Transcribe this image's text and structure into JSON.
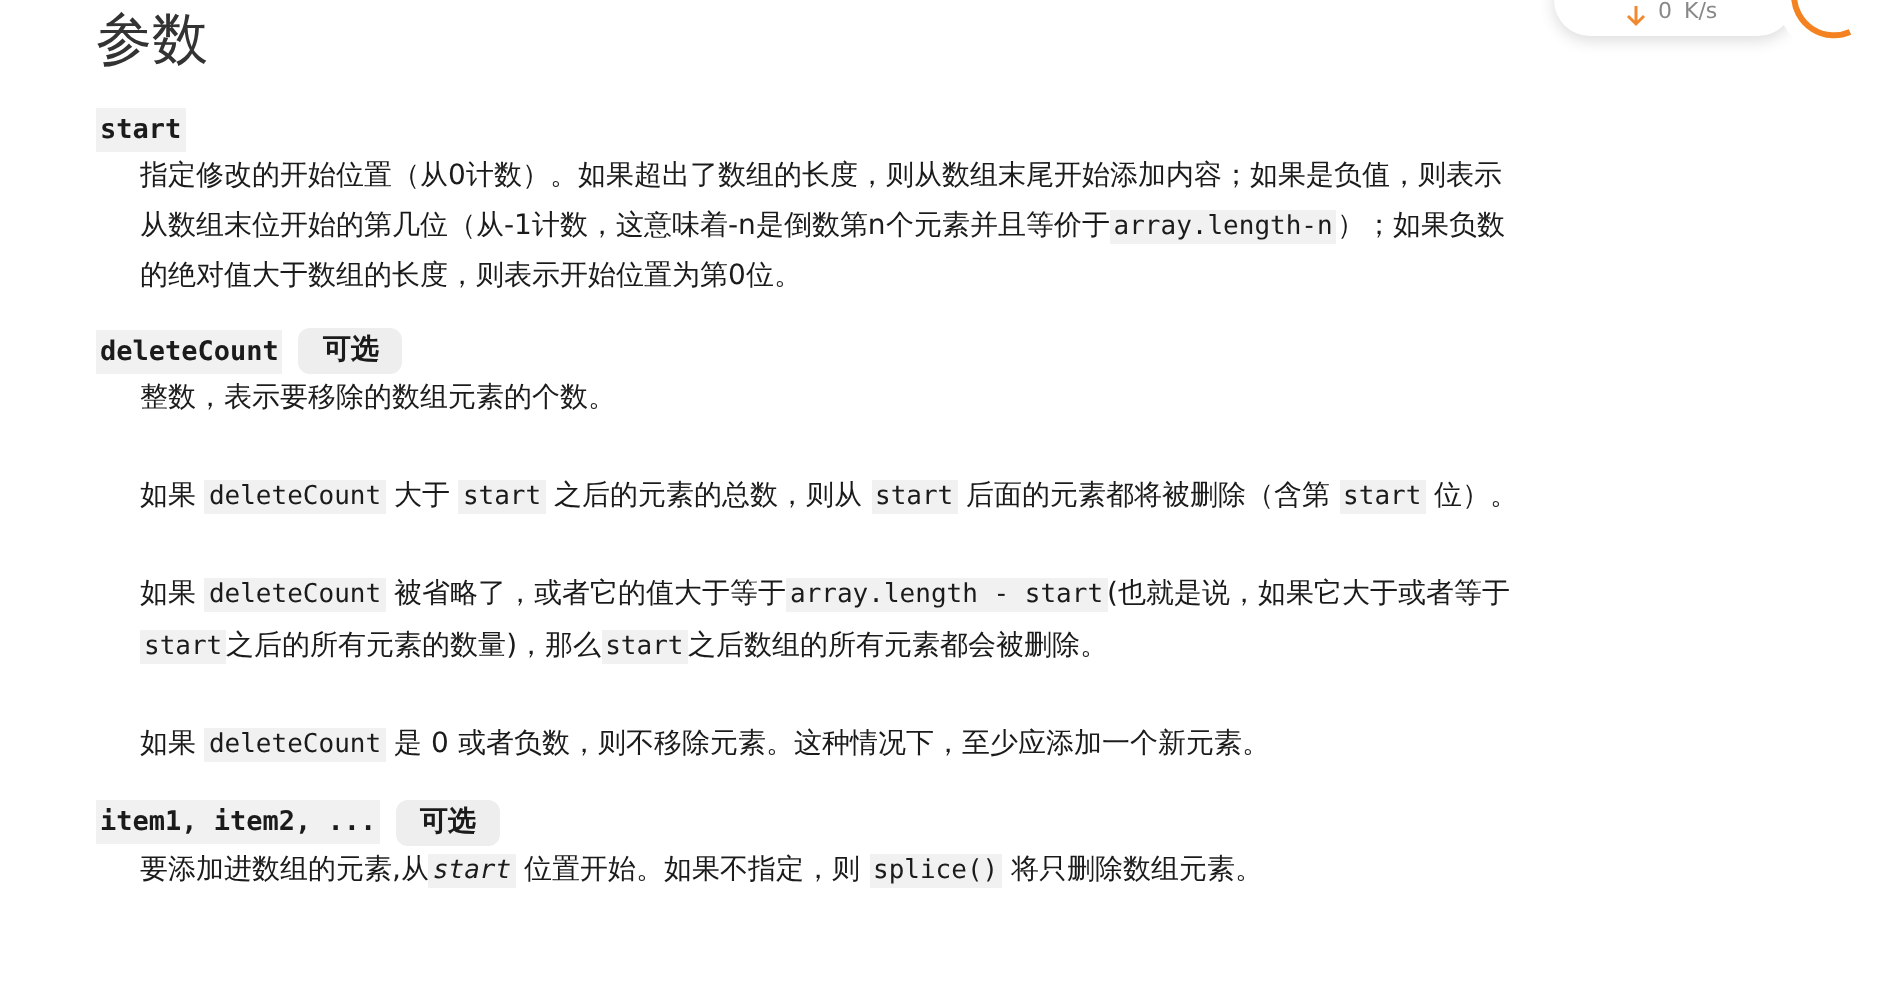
{
  "title": "参数",
  "speed_widget": {
    "value": "0",
    "unit": "K/s"
  },
  "params": [
    {
      "name": "start",
      "paragraphs": [
        [
          {
            "kind": "text",
            "text": "指定修改的开始位置（从0计数）。如果超出了数组的长度，则从数组末尾开始添加内容；如果是负值，则表示从数组末位开始的第几位（从-1计数，这意味着-n是倒数第n个元素并且等价于"
          },
          {
            "kind": "code",
            "text": "array.length-n"
          },
          {
            "kind": "text",
            "text": "）；如果负数的绝对值大于数组的长度，则表示开始位置为第0位。"
          }
        ]
      ]
    },
    {
      "name": "deleteCount",
      "badge": "可选",
      "paragraphs": [
        [
          {
            "kind": "text",
            "text": "整数，表示要移除的数组元素的个数。"
          }
        ],
        [
          {
            "kind": "text",
            "text": "如果 "
          },
          {
            "kind": "code",
            "text": "deleteCount"
          },
          {
            "kind": "text",
            "text": " 大于 "
          },
          {
            "kind": "code",
            "text": "start"
          },
          {
            "kind": "text",
            "text": " 之后的元素的总数，则从 "
          },
          {
            "kind": "code",
            "text": "start"
          },
          {
            "kind": "text",
            "text": " 后面的元素都将被删除（含第 "
          },
          {
            "kind": "code",
            "text": "start"
          },
          {
            "kind": "text",
            "text": " 位）。"
          }
        ],
        [
          {
            "kind": "text",
            "text": "如果 "
          },
          {
            "kind": "code",
            "text": "deleteCount"
          },
          {
            "kind": "text",
            "text": " 被省略了，或者它的值大于等于"
          },
          {
            "kind": "code",
            "text": "array.length - start"
          },
          {
            "kind": "text",
            "text": "(也就是说，如果它大于或者等于"
          },
          {
            "kind": "code",
            "text": "start"
          },
          {
            "kind": "text",
            "text": "之后的所有元素的数量)，那么"
          },
          {
            "kind": "code",
            "text": "start"
          },
          {
            "kind": "text",
            "text": "之后数组的所有元素都会被删除。"
          }
        ],
        [
          {
            "kind": "text",
            "text": "如果 "
          },
          {
            "kind": "code",
            "text": "deleteCount"
          },
          {
            "kind": "text",
            "text": " 是 0 或者负数，则不移除元素。这种情况下，至少应添加一个新元素。"
          }
        ]
      ]
    },
    {
      "name": "item1, item2, ...",
      "badge": "可选",
      "paragraphs": [
        [
          {
            "kind": "text",
            "text": "要添加进数组的元素,从"
          },
          {
            "kind": "code_italic",
            "text": "start"
          },
          {
            "kind": "text",
            "text": " 位置开始。如果不指定，则 "
          },
          {
            "kind": "code",
            "text": "splice()"
          },
          {
            "kind": "text",
            "text": " 将只删除数组元素。"
          }
        ]
      ]
    }
  ]
}
